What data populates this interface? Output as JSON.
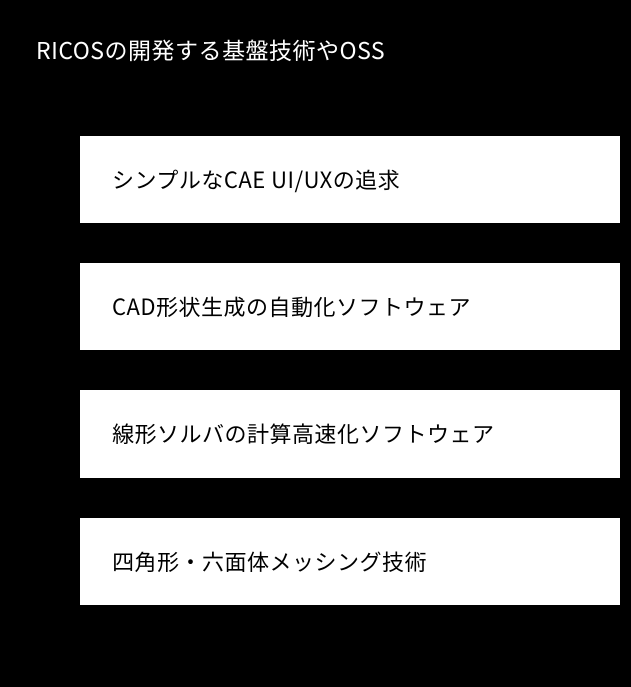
{
  "header": {
    "title": "RICOSの開発する基盤技術やOSS"
  },
  "items": [
    {
      "text": "シンプルなCAE UI/UXの追求"
    },
    {
      "text": "CAD形状生成の自動化ソフトウェア"
    },
    {
      "text": "線形ソルバの計算高速化ソフトウェア"
    },
    {
      "text": "四角形・六面体メッシング技術"
    }
  ]
}
